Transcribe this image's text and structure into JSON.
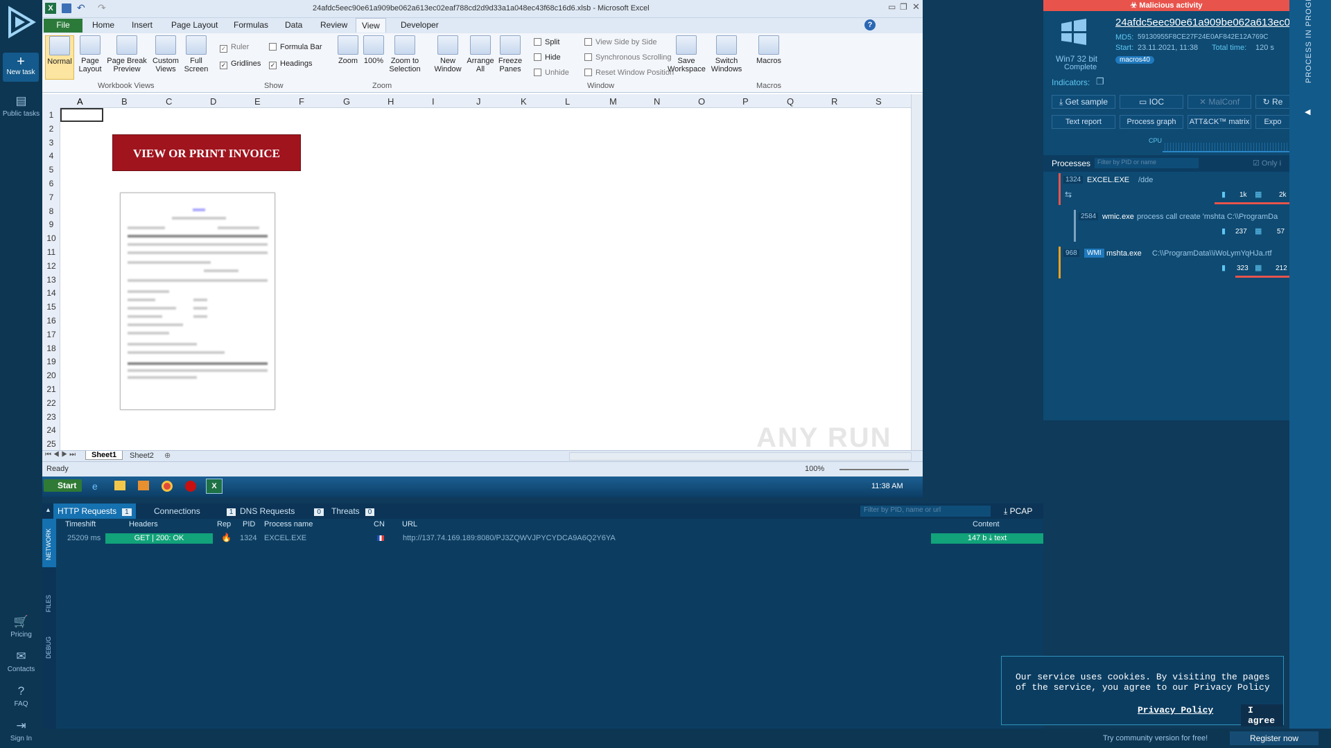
{
  "nav": {
    "new_task": "New task",
    "public_tasks": "Public tasks",
    "pricing": "Pricing",
    "contacts": "Contacts",
    "faq": "FAQ",
    "sign_in": "Sign In"
  },
  "excel": {
    "title": "24afdc5eec90e61a909be062a613ec02eaf788cd2d9d33a1a048ec43f68c16d6.xlsb - Microsoft Excel",
    "tabs": [
      "File",
      "Home",
      "Insert",
      "Page Layout",
      "Formulas",
      "Data",
      "Review",
      "View",
      "Developer"
    ],
    "ribbon": {
      "normal": "Normal",
      "page_layout": "Page Layout",
      "page_break_preview": "Page Break Preview",
      "custom_views": "Custom Views",
      "full_screen": "Full Screen",
      "ruler": "Ruler",
      "formula_bar": "Formula Bar",
      "gridlines": "Gridlines",
      "headings": "Headings",
      "zoom": "Zoom",
      "zoom100": "100%",
      "zoom_sel": "Zoom to Selection",
      "new_window": "New Window",
      "arrange_all": "Arrange All",
      "freeze_panes": "Freeze Panes",
      "split": "Split",
      "hide": "Hide",
      "unhide": "Unhide",
      "side_by_side": "View Side by Side",
      "sync_scroll": "Synchronous Scrolling",
      "reset_pos": "Reset Window Position",
      "save_ws": "Save Workspace",
      "switch_win": "Switch Windows",
      "macros": "Macros",
      "groups": [
        "Workbook Views",
        "Show",
        "Zoom",
        "Window",
        "Macros"
      ]
    },
    "columns": [
      "A",
      "B",
      "C",
      "D",
      "E",
      "F",
      "G",
      "H",
      "I",
      "J",
      "K",
      "L",
      "M",
      "N",
      "O",
      "P",
      "Q",
      "R",
      "S"
    ],
    "rows": [
      "1",
      "2",
      "3",
      "4",
      "5",
      "6",
      "7",
      "8",
      "9",
      "10",
      "11",
      "12",
      "13",
      "14",
      "15",
      "16",
      "17",
      "18",
      "19",
      "20",
      "21",
      "22",
      "23",
      "24",
      "25"
    ],
    "invoice_button": "VIEW OR PRINT INVOICE",
    "sheets": [
      "Sheet1",
      "Sheet2"
    ],
    "status": "Ready",
    "zoom_pct": "100%",
    "start": "Start",
    "clock": "11:38 AM"
  },
  "report": {
    "malicious": "Malicious activity",
    "hash": "24afdc5eec90e61a909be062a613ec0...",
    "os": "Win7 32 bit",
    "os_status": "Complete",
    "md5_label": "MD5:",
    "md5": "59130955F8CE27F24E0AF842E12A769C",
    "start_label": "Start:",
    "start": "23.11.2021, 11:38",
    "total_label": "Total time:",
    "total": "120 s",
    "tag": "macros40",
    "indicators": "Indicators:",
    "buttons": [
      "Get sample",
      "IOC",
      "MalConf",
      "Re"
    ],
    "buttons2": [
      "Text report",
      "Process graph",
      "ATT&CK™ matrix",
      "Expo"
    ],
    "cpu": "CPU",
    "processes_label": "Processes",
    "filter_placeholder": "Filter by PID or name",
    "only_label": "Only i",
    "procs": [
      {
        "pid": "1324",
        "name": "EXCEL.EXE",
        "args": "/dde",
        "a": "1k",
        "b": "2k"
      },
      {
        "pid": "2584",
        "name": "wmic.exe",
        "args": "process call create 'mshta C:\\\\ProgramDa",
        "a": "237",
        "b": "57"
      },
      {
        "pid": "968",
        "name": "mshta.exe",
        "args": "C:\\\\ProgramData\\\\iWoLymYqHJa.rtf",
        "a": "323",
        "b": "212",
        "tag": "WMI"
      }
    ],
    "sidebar_label": "PROCESS IN PROGRESS"
  },
  "network": {
    "tabs": [
      {
        "label": "HTTP Requests",
        "count": "1"
      },
      {
        "label": "Connections",
        "count": "1"
      },
      {
        "label": "DNS Requests",
        "count": "0"
      },
      {
        "label": "Threats",
        "count": "0"
      }
    ],
    "filter_placeholder": "Filter by PID, name or url",
    "pcap": "PCAP",
    "side": [
      "NETWORK",
      "FILES",
      "DEBUG"
    ],
    "headers": [
      "Timeshift",
      "Headers",
      "Rep",
      "PID",
      "Process name",
      "CN",
      "URL",
      "Content"
    ],
    "row": {
      "time": "25209 ms",
      "method": "GET",
      "status": "200: OK",
      "pid": "1324",
      "proc": "EXCEL.EXE",
      "url": "http://137.74.169.189:8080/PJ3ZQWVJPYCYDCA9A6Q2Y6YA",
      "size": "147 b",
      "type": "text"
    }
  },
  "cookie": {
    "text": "Our service uses cookies. By visiting the pages of the service, you agree to our Privacy Policy",
    "link": "Privacy Policy",
    "agree": "I agree"
  },
  "bottom": {
    "community": "Try community version for free!",
    "register": "Register now"
  },
  "watermark": "ANY RUN"
}
